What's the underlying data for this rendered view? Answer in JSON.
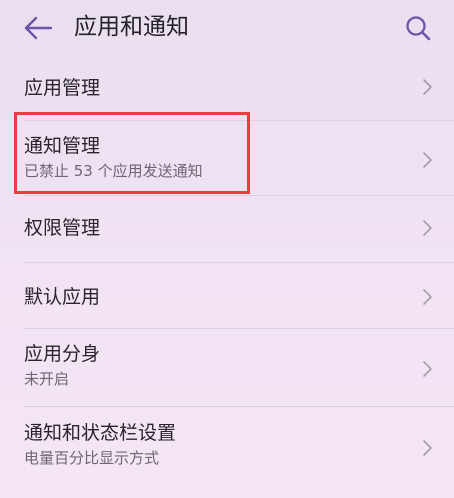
{
  "header": {
    "back_icon": "arrow-left-icon",
    "title": "应用和通知",
    "search_icon": "search-icon"
  },
  "list": {
    "items": [
      {
        "title": "应用管理",
        "subtitle": ""
      },
      {
        "title": "通知管理",
        "subtitle": "已禁止 53 个应用发送通知"
      },
      {
        "title": "权限管理",
        "subtitle": ""
      },
      {
        "title": "默认应用",
        "subtitle": ""
      },
      {
        "title": "应用分身",
        "subtitle": "未开启"
      },
      {
        "title": "通知和状态栏设置",
        "subtitle": "电量百分比显示方式"
      }
    ]
  },
  "colors": {
    "accent": "#6b55a8",
    "highlight": "#ee3a43",
    "chevron": "#a79aaa"
  }
}
